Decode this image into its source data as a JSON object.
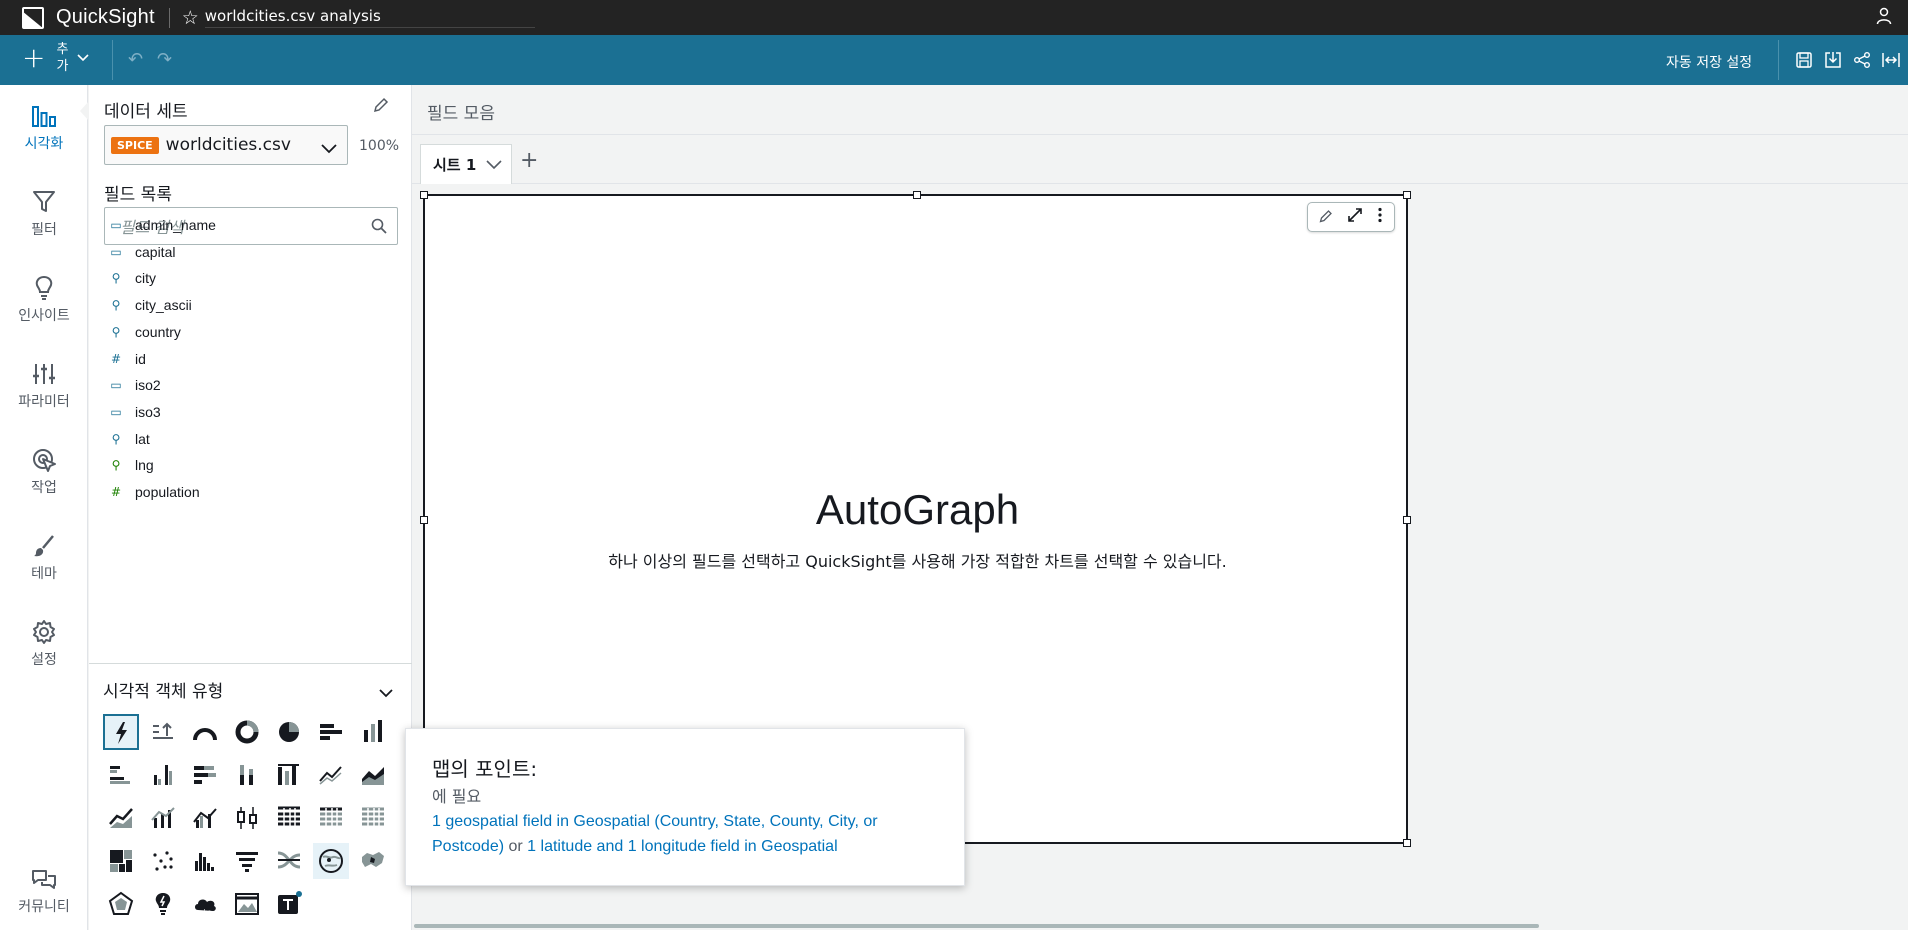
{
  "app": {
    "name": "QuickSight"
  },
  "header": {
    "analysis_title": "worldcities.csv analysis"
  },
  "toolbar": {
    "add_label": "추가",
    "autosave_label": "자동 저장 설정"
  },
  "nav": {
    "items": [
      {
        "label": "시각화"
      },
      {
        "label": "필터"
      },
      {
        "label": "인사이트"
      },
      {
        "label": "파라미터"
      },
      {
        "label": "작업"
      },
      {
        "label": "테마"
      },
      {
        "label": "설정"
      },
      {
        "label": "커뮤니티"
      }
    ]
  },
  "dataset": {
    "section_title": "데이터 세트",
    "badge": "SPICE",
    "name": "worldcities.csv",
    "percent": "100%"
  },
  "fields": {
    "section_title": "필드 목록",
    "search_placeholder": "필드 검색",
    "items": [
      {
        "name": "admin_name",
        "type": "string"
      },
      {
        "name": "capital",
        "type": "string"
      },
      {
        "name": "city",
        "type": "geo"
      },
      {
        "name": "city_ascii",
        "type": "geo"
      },
      {
        "name": "country",
        "type": "geo"
      },
      {
        "name": "id",
        "type": "number"
      },
      {
        "name": "iso2",
        "type": "string"
      },
      {
        "name": "iso3",
        "type": "string"
      },
      {
        "name": "lat",
        "type": "geo"
      },
      {
        "name": "lng",
        "type": "geo-green"
      },
      {
        "name": "population",
        "type": "number-green"
      }
    ]
  },
  "visual_types": {
    "section_title": "시각적 객체 유형"
  },
  "main": {
    "field_wells_label": "필드 모음",
    "sheet_tab_label": "시트 1"
  },
  "visual": {
    "title": "AutoGraph",
    "subtitle": "하나 이상의 필드를 선택하고 QuickSight를 사용해 가장 적합한 차트를 선택할 수 있습니다."
  },
  "tooltip": {
    "title": "맵의 포인트:",
    "requires": "에 필요",
    "link1": "1 geospatial field in Geospatial (Country, State, County, City, or Postcode)",
    "or": " or ",
    "link2": "1 latitude and 1 longitude field in Geospatial"
  },
  "colors": {
    "topbar": "#232323",
    "toolbar": "#1b7093",
    "accent": "#0073bb",
    "spice": "#ec7211"
  }
}
